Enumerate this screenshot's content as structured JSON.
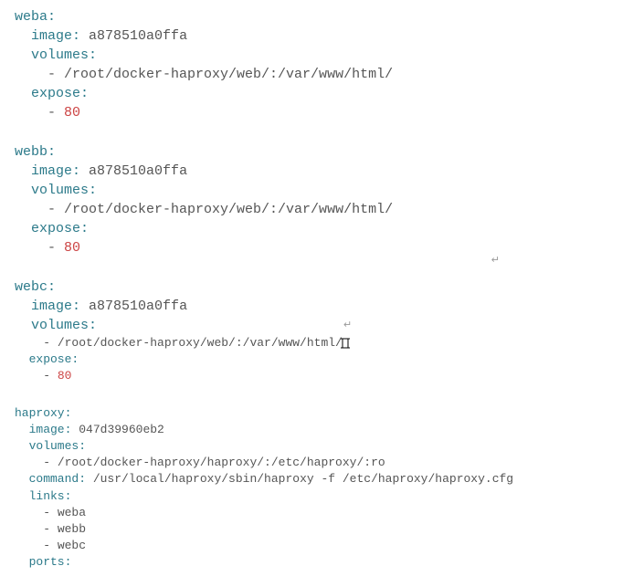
{
  "services": {
    "weba": {
      "name": "weba",
      "image_key": "image",
      "image": "a878510a0ffa",
      "volumes_key": "volumes",
      "volumes": [
        "/root/docker-haproxy/web/:/var/www/html/"
      ],
      "expose_key": "expose",
      "expose": [
        "80"
      ]
    },
    "webb": {
      "name": "webb",
      "image_key": "image",
      "image": "a878510a0ffa",
      "volumes_key": "volumes",
      "volumes": [
        "/root/docker-haproxy/web/:/var/www/html/"
      ],
      "expose_key": "expose",
      "expose": [
        "80"
      ]
    },
    "webc": {
      "name": "webc",
      "image_key": "image",
      "image": "a878510a0ffa",
      "volumes_key": "volumes",
      "volumes": [
        "/root/docker-haproxy/web/:/var/www/html/"
      ],
      "expose_key": "expose",
      "expose": [
        "80"
      ]
    },
    "haproxy": {
      "name": "haproxy",
      "image_key": "image",
      "image": "047d39960eb2",
      "volumes_key": "volumes",
      "volumes": [
        "/root/docker-haproxy/haproxy/:/etc/haproxy/:ro"
      ],
      "command_key": "command",
      "command": "/usr/local/haproxy/sbin/haproxy -f /etc/haproxy/haproxy.cfg",
      "links_key": "links",
      "links": [
        "weba",
        "webb",
        "webc"
      ],
      "ports_key": "ports"
    }
  },
  "glyphs": {
    "colon": ":",
    "dash": "- ",
    "return": "↵"
  }
}
